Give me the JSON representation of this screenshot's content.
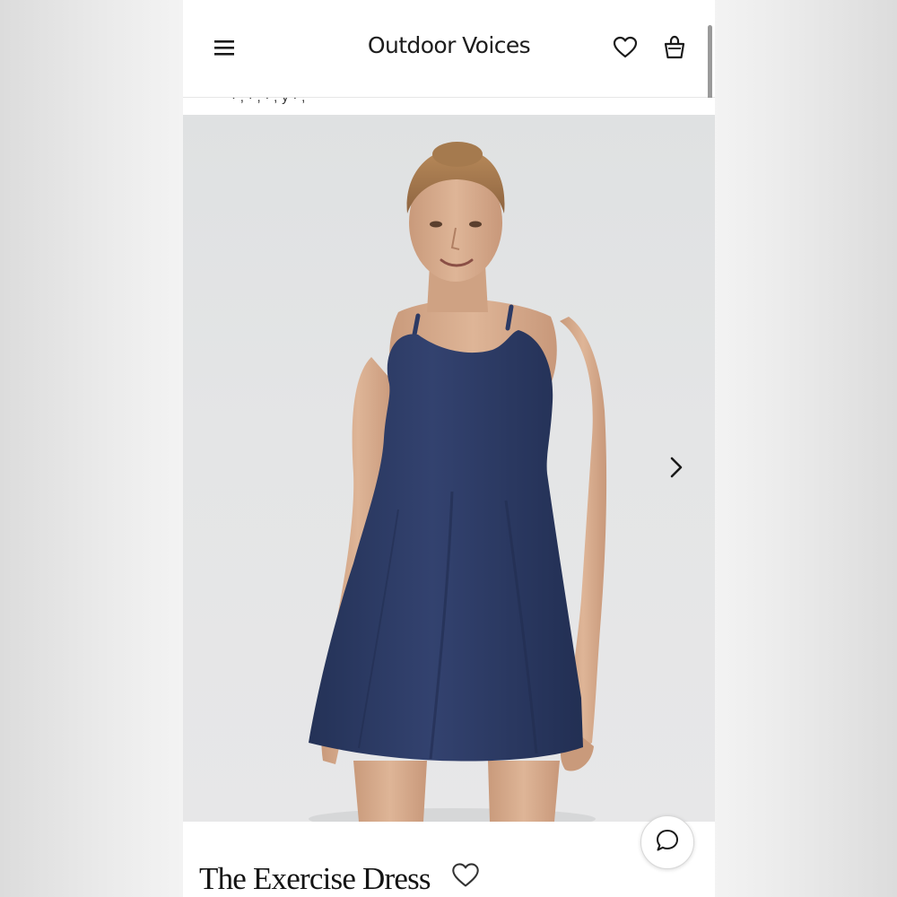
{
  "header": {
    "brand": "Outdoor Voices",
    "menu_icon": "hamburger-menu-icon",
    "wishlist_icon": "heart-outline-icon",
    "bag_icon": "shopping-bag-icon"
  },
  "promo": {
    "text": "·  ,          ·  ,                    ·  ,        y  ·  ,"
  },
  "gallery": {
    "next_icon": "chevron-right-icon",
    "dress_color": "#2c3a64",
    "background_color": "#e2e3e4"
  },
  "product": {
    "title": "The Exercise Dress",
    "favorite_icon": "heart-outline-icon"
  },
  "chat": {
    "icon": "chat-bubble-icon"
  }
}
